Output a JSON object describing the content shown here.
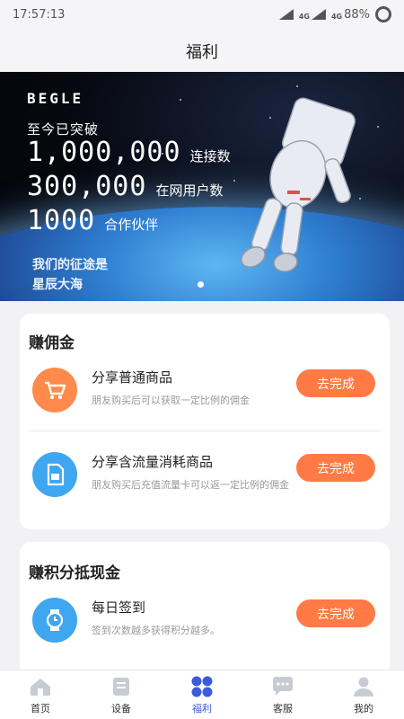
{
  "status": {
    "time": "17:57:13",
    "network_a": "4G",
    "network_b": "4G",
    "battery": "88%"
  },
  "page": {
    "title": "福利"
  },
  "banner": {
    "brand": "BEGLE",
    "headline": "至今已突破",
    "stats": [
      {
        "value": "1,000,000",
        "label": "连接数"
      },
      {
        "value": "300,000",
        "label": "在网用户数"
      },
      {
        "value": "1000",
        "label": "合作伙伴"
      }
    ],
    "slogan_1": "我们的征途是",
    "slogan_2": "星辰大海"
  },
  "commission": {
    "title": "赚佣金",
    "items": [
      {
        "title": "分享普通商品",
        "desc": "朋友购买后可以获取一定比例的佣金",
        "button": "去完成",
        "icon": "shopping-cart-icon",
        "color": "#ff8a4c"
      },
      {
        "title": "分享含流量消耗商品",
        "desc": "朋友购买后充值流量卡可以返一定比例的佣金",
        "button": "去完成",
        "icon": "sim-card-icon",
        "color": "#3fa6f0"
      }
    ]
  },
  "points": {
    "title": "赚积分抵现金",
    "items": [
      {
        "title": "每日签到",
        "desc": "签到次数越多获得积分越多。",
        "button": "去完成",
        "icon": "watch-icon",
        "color": "#3fa6f0"
      }
    ]
  },
  "tabbar": {
    "items": [
      {
        "label": "首页",
        "icon": "home-icon"
      },
      {
        "label": "设备",
        "icon": "device-icon"
      },
      {
        "label": "福利",
        "icon": "benefits-icon"
      },
      {
        "label": "客服",
        "icon": "chat-icon"
      },
      {
        "label": "我的",
        "icon": "user-icon"
      }
    ],
    "active_color": "#3b5bdb"
  }
}
